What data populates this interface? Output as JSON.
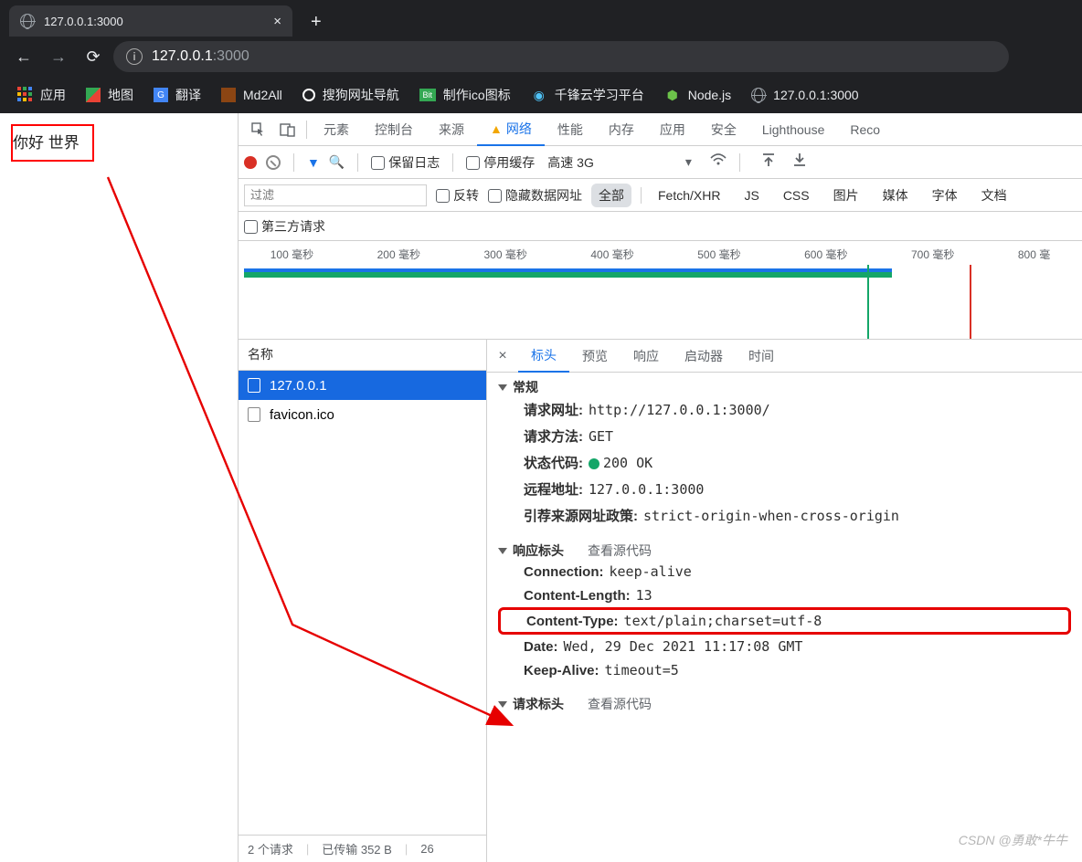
{
  "tab": {
    "title": "127.0.0.1:3000"
  },
  "url": {
    "host": "127.0.0.1",
    "port": ":3000"
  },
  "bookmarks": {
    "apps": "应用",
    "items": [
      "地图",
      "翻译",
      "Md2All",
      "搜狗网址导航",
      "制作ico图标",
      "千锋云学习平台",
      "Node.js",
      "127.0.0.1:3000"
    ]
  },
  "page": {
    "hello": "你好 世界"
  },
  "devtools": {
    "tabs": {
      "elements": "元素",
      "console": "控制台",
      "sources": "来源",
      "network": "网络",
      "performance": "性能",
      "memory": "内存",
      "application": "应用",
      "security": "安全",
      "lighthouse": "Lighthouse",
      "recorder": "Reco"
    },
    "bar2": {
      "preserve": "保留日志",
      "disableCache": "停用缓存",
      "throttle": "高速 3G"
    },
    "filter": {
      "placeholder": "过滤",
      "invert": "反转",
      "hideData": "隐藏数据网址",
      "all": "全部",
      "types": [
        "Fetch/XHR",
        "JS",
        "CSS",
        "图片",
        "媒体",
        "字体",
        "文档"
      ],
      "thirdParty": "第三方请求"
    },
    "timeline": {
      "ticks": [
        "100 毫秒",
        "200 毫秒",
        "300 毫秒",
        "400 毫秒",
        "500 毫秒",
        "600 毫秒",
        "700 毫秒",
        "800 毫"
      ]
    },
    "list": {
      "header": "名称",
      "rows": [
        "127.0.0.1",
        "favicon.ico"
      ],
      "status": {
        "count": "2 个请求",
        "transferred": "已传输 352 B",
        "extra": "26"
      }
    },
    "detail": {
      "tabs": {
        "headers": "标头",
        "preview": "预览",
        "response": "响应",
        "initiator": "启动器",
        "timing": "时间"
      },
      "general": {
        "title": "常规",
        "url_l": "请求网址:",
        "url_v": "http://127.0.0.1:3000/",
        "method_l": "请求方法:",
        "method_v": "GET",
        "status_l": "状态代码:",
        "status_v": "200 OK",
        "remote_l": "远程地址:",
        "remote_v": "127.0.0.1:3000",
        "referrer_l": "引荐来源网址政策:",
        "referrer_v": "strict-origin-when-cross-origin"
      },
      "respHeaders": {
        "title": "响应标头",
        "viewSource": "查看源代码",
        "h": {
          "connection_l": "Connection:",
          "connection_v": "keep-alive",
          "clen_l": "Content-Length:",
          "clen_v": "13",
          "ctype_l": "Content-Type:",
          "ctype_v": "text/plain;charset=utf-8",
          "date_l": "Date:",
          "date_v": "Wed, 29 Dec 2021 11:17:08 GMT",
          "kalive_l": "Keep-Alive:",
          "kalive_v": "timeout=5"
        }
      },
      "reqHeaders": {
        "title": "请求标头",
        "viewSource": "查看源代码"
      }
    }
  },
  "watermark": "CSDN @勇敢*牛牛"
}
